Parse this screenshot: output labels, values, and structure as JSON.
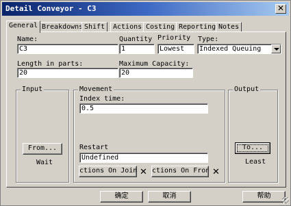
{
  "window": {
    "title": "Detail Conveyor - C3",
    "close_label": "✕"
  },
  "tabs": [
    {
      "label": "General",
      "active": true
    },
    {
      "label": "Breakdowns"
    },
    {
      "label": "Shift"
    },
    {
      "label": "Actions"
    },
    {
      "label": "Costing"
    },
    {
      "label": "Reporting"
    },
    {
      "label": "Notes"
    }
  ],
  "fields": {
    "name": {
      "label": "Name:",
      "value": "C3"
    },
    "quantity": {
      "label": "Quantity",
      "value": "1"
    },
    "priority": {
      "label": "Priority",
      "value": "Lowest"
    },
    "type": {
      "label": "Type:",
      "value": "Indexed Queuing"
    },
    "length": {
      "label": "Length in parts:",
      "value": "20"
    },
    "max_capacity": {
      "label": "Maximum Capacity:",
      "value": "20"
    }
  },
  "input_group": {
    "title": "Input",
    "from_button": "From...",
    "status": "Wait"
  },
  "movement_group": {
    "title": "Movement",
    "index_time_label": "Index time:",
    "index_time_value": "0.5",
    "restart_label": "Restart",
    "restart_value": "Undefined",
    "actions_on_join": "ctions On Join...",
    "actions_on_front": "ctions On Front..."
  },
  "output_group": {
    "title": "Output",
    "to_button": "To...",
    "status": "Least"
  },
  "bottom_buttons": {
    "ok": "确定",
    "cancel": "取消",
    "help": "帮助"
  }
}
